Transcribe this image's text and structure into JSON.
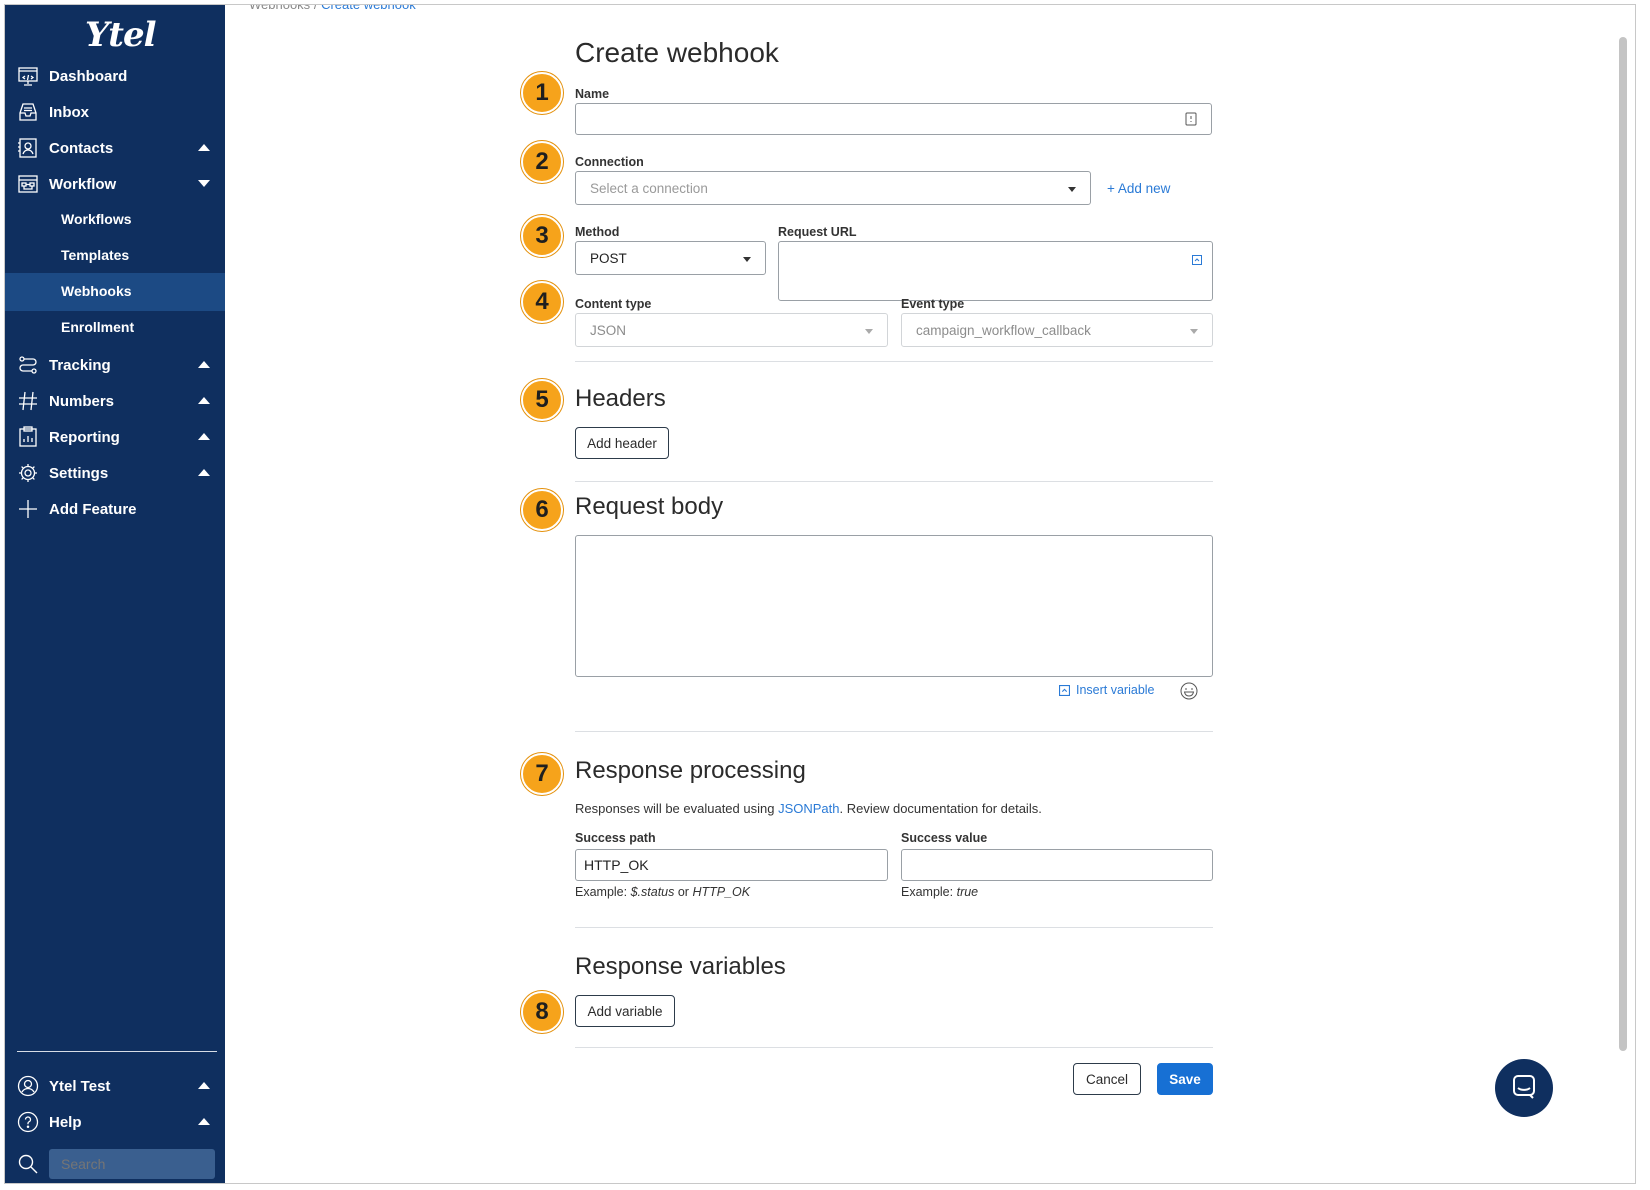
{
  "sidebar": {
    "logo": "Ytel",
    "nav": [
      {
        "label": "Dashboard",
        "icon": "dashboard-icon"
      },
      {
        "label": "Inbox",
        "icon": "inbox-icon"
      },
      {
        "label": "Contacts",
        "icon": "contacts-icon",
        "caret": "up"
      },
      {
        "label": "Workflow",
        "icon": "workflow-icon",
        "caret": "down"
      }
    ],
    "workflow_sub": [
      {
        "label": "Workflows",
        "active": false
      },
      {
        "label": "Templates",
        "active": false
      },
      {
        "label": "Webhooks",
        "active": true
      },
      {
        "label": "Enrollment",
        "active": false
      }
    ],
    "nav2": [
      {
        "label": "Tracking",
        "icon": "tracking-icon",
        "caret": "up"
      },
      {
        "label": "Numbers",
        "icon": "hash-icon",
        "caret": "up"
      },
      {
        "label": "Reporting",
        "icon": "reporting-icon",
        "caret": "up"
      },
      {
        "label": "Settings",
        "icon": "gear-icon",
        "caret": "up"
      },
      {
        "label": "Add Feature",
        "icon": "plus-icon"
      }
    ],
    "account": {
      "label": "Ytel Test",
      "icon": "user-icon"
    },
    "help": {
      "label": "Help",
      "icon": "help-icon"
    },
    "search_placeholder": "Search"
  },
  "breadcrumb": {
    "parent": "Webhooks",
    "sep": "/",
    "current": "Create webhook"
  },
  "form": {
    "title": "Create webhook",
    "steps": [
      "1",
      "2",
      "3",
      "4",
      "5",
      "6",
      "7",
      "8"
    ],
    "name_label": "Name",
    "name_value": "",
    "connection_label": "Connection",
    "connection_placeholder": "Select a connection",
    "add_new": "+ Add new",
    "method_label": "Method",
    "method_value": "POST",
    "request_url_label": "Request URL",
    "content_type_label": "Content type",
    "content_type_value": "JSON",
    "event_type_label": "Event type",
    "event_type_value": "campaign_workflow_callback",
    "headers_title": "Headers",
    "add_header": "Add header",
    "request_body_title": "Request body",
    "insert_variable": "Insert variable",
    "response_processing_title": "Response processing",
    "response_note_pre": "Responses will be evaluated using ",
    "response_note_link": "JSONPath",
    "response_note_post": ". Review documentation for details.",
    "success_path_label": "Success path",
    "success_path_value": "HTTP_OK",
    "success_path_example_pre": "Example: ",
    "success_path_example_a": "$.status",
    "success_path_example_mid": " or ",
    "success_path_example_b": "HTTP_OK",
    "success_value_label": "Success value",
    "success_value_value": "",
    "success_value_example_pre": "Example: ",
    "success_value_example": "true",
    "response_variables_title": "Response variables",
    "add_variable": "Add variable",
    "cancel": "Cancel",
    "save": "Save"
  },
  "colors": {
    "sidebar": "#0f2f5f",
    "active_item": "#1c4a84",
    "badge": "#f6a31b",
    "primary": "#1770d4",
    "link": "#2a7ad6"
  }
}
